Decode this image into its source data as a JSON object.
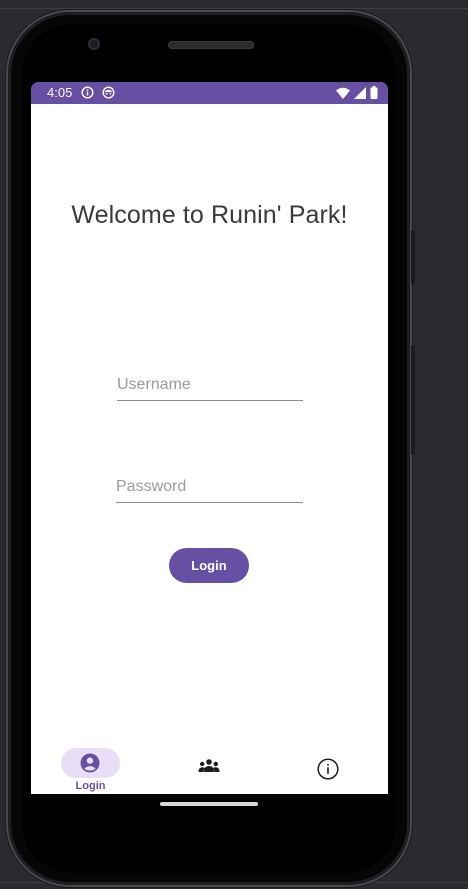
{
  "statusbar": {
    "time": "4:05",
    "left_icons": [
      "info-icon",
      "face-icon"
    ],
    "right_icons": [
      "wifi-icon",
      "signal-icon",
      "battery-icon"
    ]
  },
  "main": {
    "title": "Welcome to Runin' Park!",
    "username": {
      "placeholder": "Username",
      "value": ""
    },
    "password": {
      "placeholder": "Password",
      "value": ""
    },
    "login_button": "Login"
  },
  "bottom_nav": {
    "items": [
      {
        "label": "Login",
        "icon": "account-circle-icon",
        "selected": true
      },
      {
        "label": "",
        "icon": "groups-icon",
        "selected": false
      },
      {
        "label": "",
        "icon": "info-outline-icon",
        "selected": false
      }
    ]
  },
  "colors": {
    "primary": "#6750a4",
    "nav_indicator": "#e8def8",
    "title_text": "#3a3a3d",
    "emulator_background": "#2b2b2f"
  }
}
